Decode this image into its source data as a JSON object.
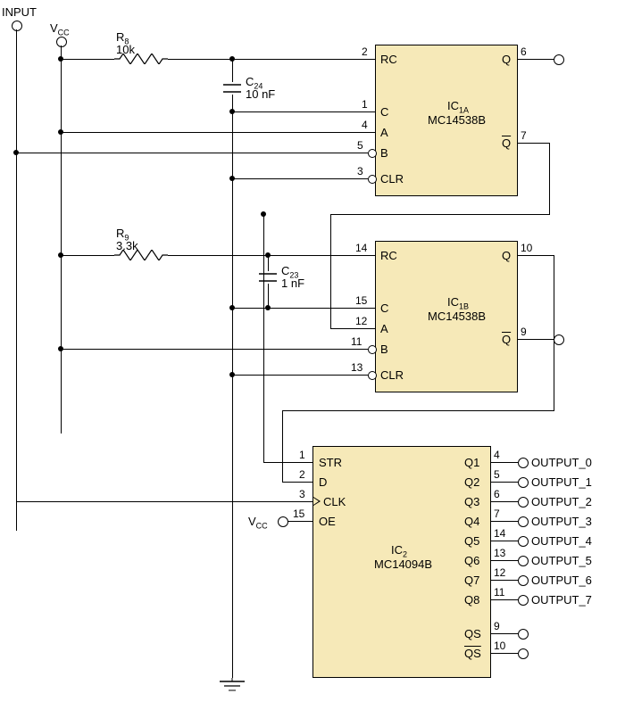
{
  "signals": {
    "input": "INPUT",
    "vcc": "V",
    "vcc_sub": "CC"
  },
  "components": {
    "R8": {
      "ref": "R",
      "ref_sub": "8",
      "value": "10k"
    },
    "R9": {
      "ref": "R",
      "ref_sub": "9",
      "value": "3.3k"
    },
    "C24": {
      "ref": "C",
      "ref_sub": "24",
      "value": "10 nF"
    },
    "C23": {
      "ref": "C",
      "ref_sub": "23",
      "value": "1 nF"
    }
  },
  "ic1a": {
    "title_ref": "IC",
    "title_sub": "1A",
    "part": "MC14538B",
    "pins_left": [
      {
        "num": "2",
        "name": "RC"
      },
      {
        "num": "1",
        "name": "C"
      },
      {
        "num": "4",
        "name": "A"
      },
      {
        "num": "5",
        "name": "B",
        "inv": true
      },
      {
        "num": "3",
        "name": "CLR",
        "inv": true
      }
    ],
    "pins_right": [
      {
        "num": "6",
        "name": "Q"
      },
      {
        "num": "7",
        "name": "Q",
        "over": true
      }
    ]
  },
  "ic1b": {
    "title_ref": "IC",
    "title_sub": "1B",
    "part": "MC14538B",
    "pins_left": [
      {
        "num": "14",
        "name": "RC"
      },
      {
        "num": "15",
        "name": "C"
      },
      {
        "num": "12",
        "name": "A"
      },
      {
        "num": "11",
        "name": "B",
        "inv": true
      },
      {
        "num": "13",
        "name": "CLR",
        "inv": true
      }
    ],
    "pins_right": [
      {
        "num": "10",
        "name": "Q"
      },
      {
        "num": "9",
        "name": "Q",
        "over": true
      }
    ]
  },
  "ic2": {
    "title_ref": "IC",
    "title_sub": "2",
    "part": "MC14094B",
    "pins_left": [
      {
        "num": "1",
        "name": "STR"
      },
      {
        "num": "2",
        "name": "D"
      },
      {
        "num": "3",
        "name": "CLK",
        "clk": true
      },
      {
        "num": "15",
        "name": "OE"
      }
    ],
    "pins_right": [
      {
        "num": "4",
        "name": "Q1",
        "out": "OUTPUT_0"
      },
      {
        "num": "5",
        "name": "Q2",
        "out": "OUTPUT_1"
      },
      {
        "num": "6",
        "name": "Q3",
        "out": "OUTPUT_2"
      },
      {
        "num": "7",
        "name": "Q4",
        "out": "OUTPUT_3"
      },
      {
        "num": "14",
        "name": "Q5",
        "out": "OUTPUT_4"
      },
      {
        "num": "13",
        "name": "Q6",
        "out": "OUTPUT_5"
      },
      {
        "num": "12",
        "name": "Q7",
        "out": "OUTPUT_6"
      },
      {
        "num": "11",
        "name": "Q8",
        "out": "OUTPUT_7"
      },
      {
        "num": "9",
        "name": "QS",
        "over": false
      },
      {
        "num": "10",
        "name": "QS",
        "over": true
      }
    ]
  }
}
